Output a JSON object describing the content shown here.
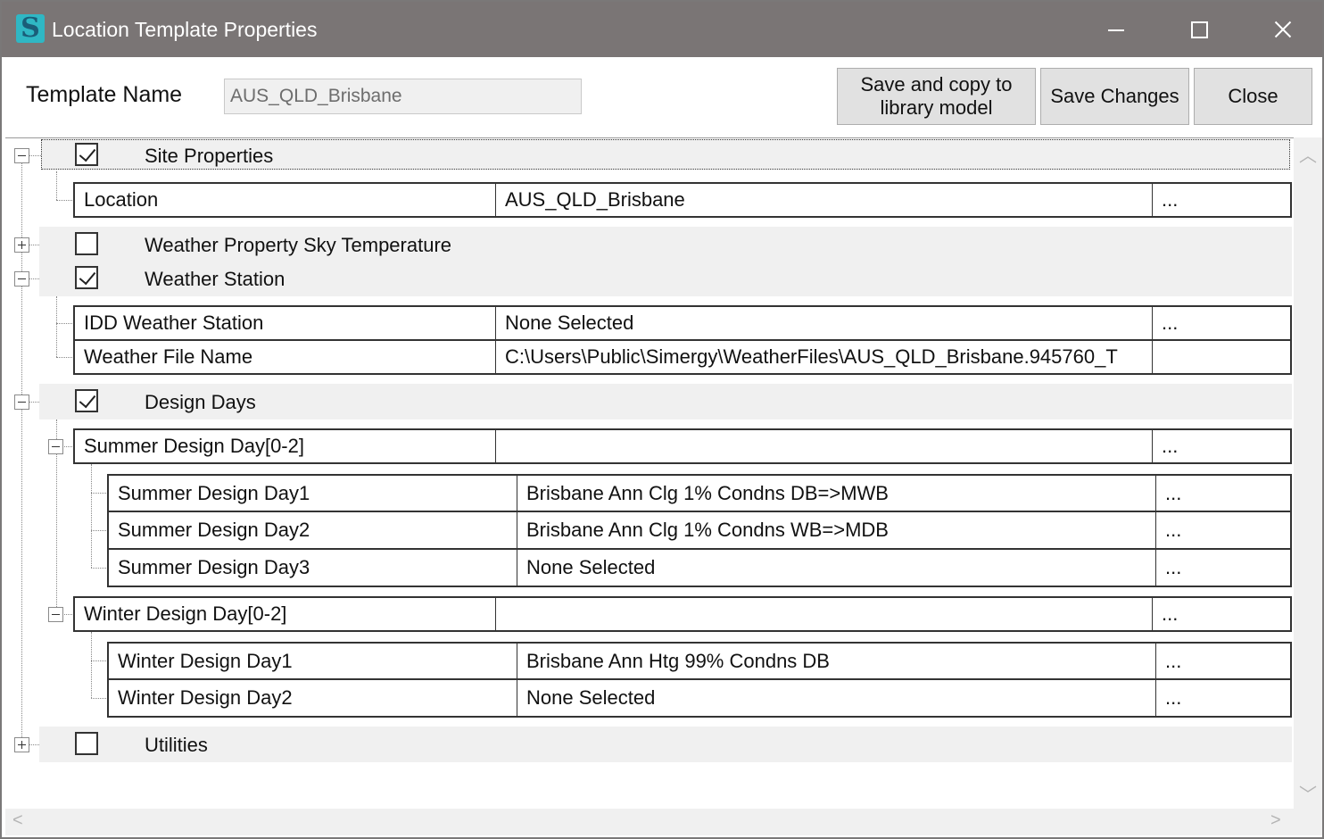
{
  "window": {
    "title": "Location Template Properties",
    "minimize_glyph": "",
    "maximize_glyph": "",
    "close_glyph": ""
  },
  "header": {
    "template_name_label": "Template Name",
    "template_name_value": "AUS_QLD_Brisbane",
    "buttons": {
      "save_copy": "Save and copy to library model",
      "save_changes": "Save Changes",
      "close": "Close"
    }
  },
  "groups": {
    "site_properties": {
      "label": "Site Properties",
      "checked": true,
      "expanded": true,
      "rows": [
        {
          "name": "Location",
          "value": "AUS_QLD_Brisbane",
          "more": "..."
        }
      ]
    },
    "weather_sky_temp": {
      "label": "Weather Property Sky Temperature",
      "checked": false,
      "expanded": false
    },
    "weather_station": {
      "label": "Weather Station",
      "checked": true,
      "expanded": true,
      "rows": [
        {
          "name": "IDD Weather Station",
          "value": "None Selected",
          "more": "..."
        },
        {
          "name": "Weather File Name",
          "value": "C:\\Users\\Public\\Simergy\\WeatherFiles\\AUS_QLD_Brisbane.945760_T",
          "more": ""
        }
      ]
    },
    "design_days": {
      "label": "Design Days",
      "checked": true,
      "expanded": true,
      "summer": {
        "name": "Summer Design Day[0-2]",
        "value": "",
        "more": "...",
        "rows": [
          {
            "name": "Summer Design Day1",
            "value": "Brisbane Ann Clg 1% Condns DB=>MWB",
            "more": "..."
          },
          {
            "name": "Summer Design Day2",
            "value": "Brisbane Ann Clg 1% Condns WB=>MDB",
            "more": "..."
          },
          {
            "name": "Summer Design Day3",
            "value": "None Selected",
            "more": "..."
          }
        ]
      },
      "winter": {
        "name": "Winter Design Day[0-2]",
        "value": "",
        "more": "...",
        "rows": [
          {
            "name": "Winter Design Day1",
            "value": "Brisbane Ann Htg 99% Condns DB",
            "more": "..."
          },
          {
            "name": "Winter Design Day2",
            "value": "None Selected",
            "more": "..."
          }
        ]
      }
    },
    "utilities": {
      "label": "Utilities",
      "checked": false,
      "expanded": false
    }
  },
  "scroll": {
    "up_arrow": "︿",
    "down_arrow": "﹀",
    "left_arrow": "<",
    "right_arrow": ">"
  },
  "colors": {
    "titlebar": "#7a7575",
    "group_band": "#f0f0f0",
    "app_icon": "#2fb7c4"
  }
}
